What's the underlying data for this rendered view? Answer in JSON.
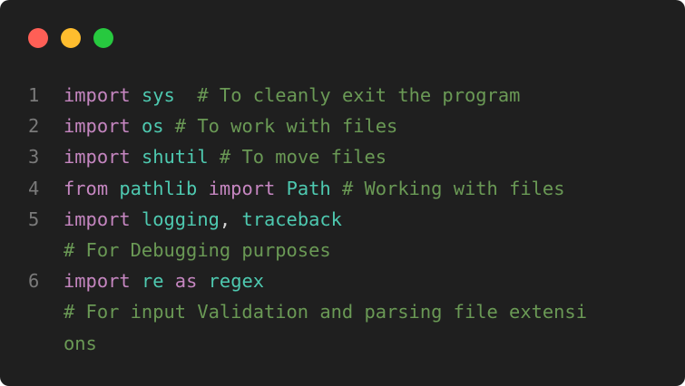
{
  "colors": {
    "background": "#1f1f1f",
    "line_number": "#7a7a7a",
    "keyword": "#c586c0",
    "identifier": "#4ec9b0",
    "plain": "#d4d4d4",
    "comment": "#6a9955",
    "light_red": "#ff5f56",
    "light_yellow": "#ffbd2e",
    "light_green": "#27c93f"
  },
  "window_controls": [
    {
      "name": "close-button",
      "color": "light_red"
    },
    {
      "name": "minimize-button",
      "color": "light_yellow"
    },
    {
      "name": "maximize-button",
      "color": "light_green"
    }
  ],
  "code_lines": [
    {
      "number": "1",
      "tokens": [
        {
          "t": "import",
          "k": "keyword"
        },
        {
          "t": " ",
          "k": "plain"
        },
        {
          "t": "sys",
          "k": "identifier"
        },
        {
          "t": "  ",
          "k": "plain"
        },
        {
          "t": "# To cleanly exit the program",
          "k": "comment"
        }
      ]
    },
    {
      "number": "2",
      "tokens": [
        {
          "t": "import",
          "k": "keyword"
        },
        {
          "t": " ",
          "k": "plain"
        },
        {
          "t": "os",
          "k": "identifier"
        },
        {
          "t": " ",
          "k": "plain"
        },
        {
          "t": "# To work with files",
          "k": "comment"
        }
      ]
    },
    {
      "number": "3",
      "tokens": [
        {
          "t": "import",
          "k": "keyword"
        },
        {
          "t": " ",
          "k": "plain"
        },
        {
          "t": "shutil",
          "k": "identifier"
        },
        {
          "t": " ",
          "k": "plain"
        },
        {
          "t": "# To move files",
          "k": "comment"
        }
      ]
    },
    {
      "number": "4",
      "tokens": [
        {
          "t": "from",
          "k": "keyword"
        },
        {
          "t": " ",
          "k": "plain"
        },
        {
          "t": "pathlib",
          "k": "identifier"
        },
        {
          "t": " ",
          "k": "plain"
        },
        {
          "t": "import",
          "k": "keyword"
        },
        {
          "t": " ",
          "k": "plain"
        },
        {
          "t": "Path",
          "k": "identifier"
        },
        {
          "t": " ",
          "k": "plain"
        },
        {
          "t": "# Working with files",
          "k": "comment"
        }
      ]
    },
    {
      "number": "5",
      "tokens": [
        {
          "t": "import",
          "k": "keyword"
        },
        {
          "t": " ",
          "k": "plain"
        },
        {
          "t": "logging",
          "k": "identifier"
        },
        {
          "t": ", ",
          "k": "plain"
        },
        {
          "t": "traceback",
          "k": "identifier"
        }
      ]
    },
    {
      "number": "",
      "tokens": [
        {
          "t": "# For Debugging purposes",
          "k": "comment"
        }
      ]
    },
    {
      "number": "6",
      "tokens": [
        {
          "t": "import",
          "k": "keyword"
        },
        {
          "t": " ",
          "k": "plain"
        },
        {
          "t": "re",
          "k": "identifier"
        },
        {
          "t": " ",
          "k": "plain"
        },
        {
          "t": "as",
          "k": "keyword"
        },
        {
          "t": " ",
          "k": "plain"
        },
        {
          "t": "regex",
          "k": "identifier"
        }
      ]
    },
    {
      "number": "",
      "tokens": [
        {
          "t": "# For input Validation and parsing file extensi",
          "k": "comment"
        }
      ]
    },
    {
      "number": "",
      "tokens": [
        {
          "t": "ons",
          "k": "comment"
        }
      ]
    }
  ]
}
